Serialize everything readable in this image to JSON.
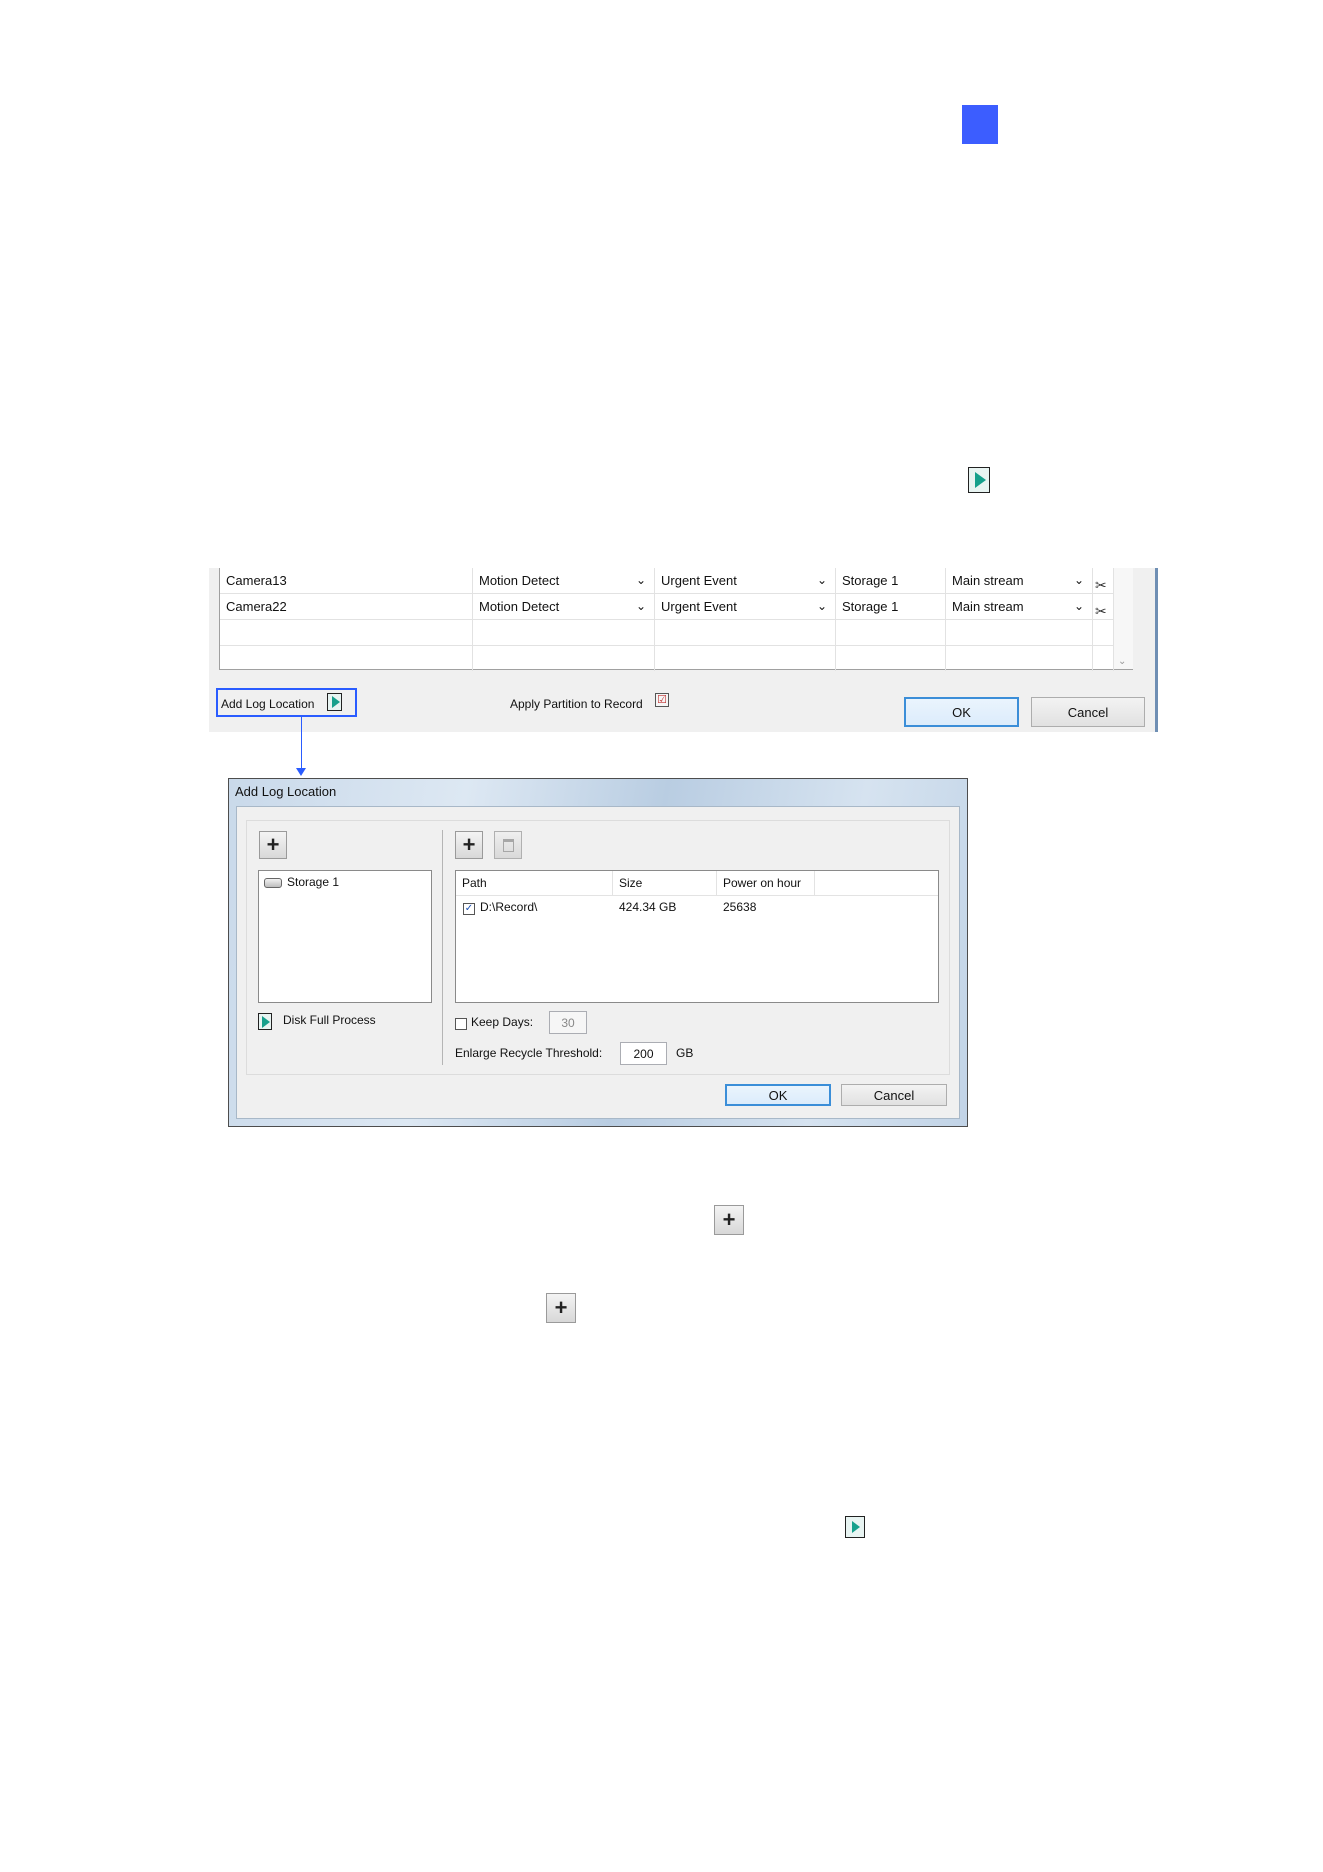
{
  "colors": {
    "accent_blue": "#3c5dff",
    "highlight_border": "#2a5cff",
    "icon_teal": "#16a08c"
  },
  "top_table": {
    "rows": [
      {
        "camera": "Camera13",
        "trigger": "Motion Detect",
        "event": "Urgent Event",
        "storage": "Storage 1",
        "stream": "Main stream"
      },
      {
        "camera": "Camera22",
        "trigger": "Motion Detect",
        "event": "Urgent Event",
        "storage": "Storage 1",
        "stream": "Main stream"
      }
    ],
    "add_log_location_label": "Add Log Location",
    "apply_partition_label": "Apply Partition to Record",
    "ok_label": "OK",
    "cancel_label": "Cancel"
  },
  "dialog": {
    "title": "Add Log Location",
    "storage_list": [
      "Storage 1"
    ],
    "disk_full_process_label": "Disk Full Process",
    "columns": [
      "Path",
      "Size",
      "Power on hour"
    ],
    "paths": [
      {
        "path": "D:\\Record\\",
        "size": "424.34 GB",
        "power_on_hour": "25638",
        "checked": true
      }
    ],
    "keep_days_label": "Keep Days:",
    "keep_days_value": "30",
    "enlarge_label": "Enlarge Recycle Threshold:",
    "enlarge_value": "200",
    "enlarge_unit": "GB",
    "ok_label": "OK",
    "cancel_label": "Cancel"
  },
  "icons": {
    "play_icon": "teal-triangle-in-box",
    "plus_icon": "+",
    "tool_icon": "scissors-wrench",
    "check_mark": "✓",
    "chevron": "⌄"
  }
}
